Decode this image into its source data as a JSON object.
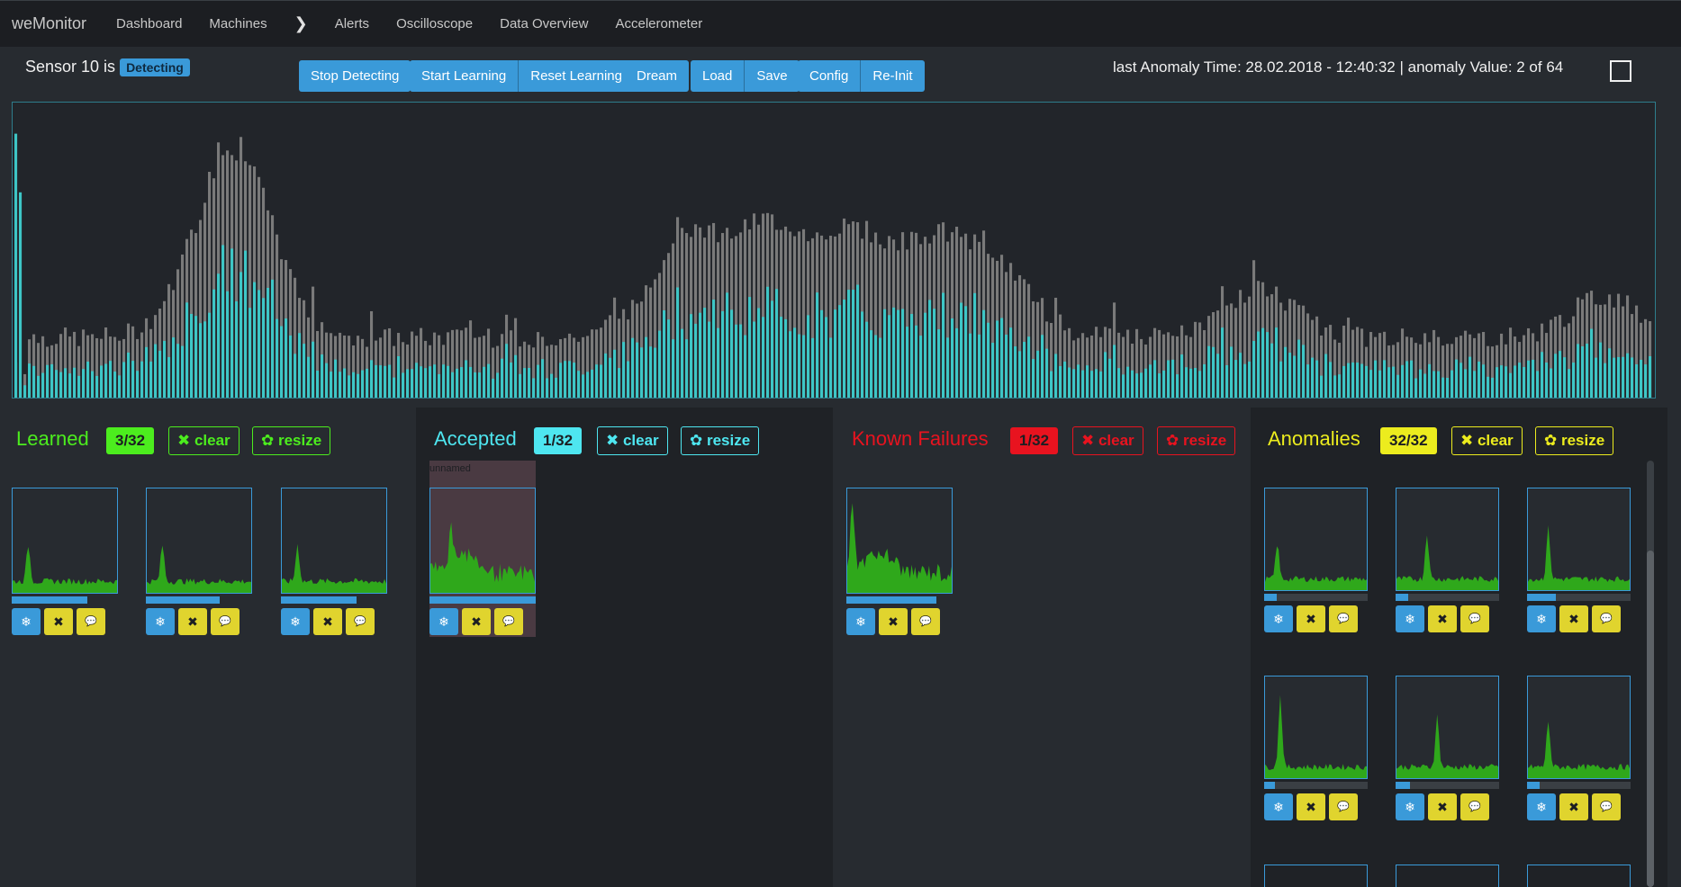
{
  "navbar": {
    "brand": "weMonitor",
    "items": [
      "Dashboard",
      "Machines",
      "Alerts",
      "Oscilloscope",
      "Data Overview",
      "Accelerometer"
    ],
    "chevron": "chevron-right-icon"
  },
  "status": {
    "sensor_text": "Sensor 10 is",
    "mode_badge": "Detecting",
    "anomaly_info": "last Anomaly Time: 28.02.2018 - 12:40:32 | anomaly Value: 2 of 64"
  },
  "toolbar": {
    "stop_detecting": "Stop Detecting",
    "start_learning": "Start Learning",
    "reset_learning": "Reset Learning",
    "dream": "Dream",
    "load": "Load",
    "save": "Save",
    "config": "Config",
    "reinit": "Re-Init"
  },
  "panels": {
    "learned": {
      "title": "Learned",
      "count": "3/32",
      "clear": "✖ clear",
      "resize": "✿ resize",
      "color": "#4ced1e"
    },
    "accepted": {
      "title": "Accepted",
      "count": "1/32",
      "clear": "✖ clear",
      "resize": "✿ resize",
      "color": "#4ee6f0",
      "thumb_label": "unnamed"
    },
    "known_failures": {
      "title": "Known Failures",
      "count": "1/32",
      "clear": "✖ clear",
      "resize": "✿ resize",
      "color": "#e8131f"
    },
    "anomalies": {
      "title": "Anomalies",
      "count": "32/32",
      "clear": "✖ clear",
      "resize": "✿ resize",
      "color": "#ecec1e"
    }
  },
  "thumb_buttons": {
    "freeze": "❄",
    "delete": "✖",
    "comment": "💬"
  },
  "colors": {
    "accent_blue": "#3a9ad9",
    "gray_bar": "#7a7a7a",
    "cyan_bar": "#3ec6c6",
    "green_spectrum": "#2fa81b"
  },
  "chart_data": {
    "type": "bar",
    "title": "",
    "xlabel": "",
    "ylabel": "",
    "series": [
      {
        "values": []
      },
      {
        "values": []
      }
    ]
  }
}
